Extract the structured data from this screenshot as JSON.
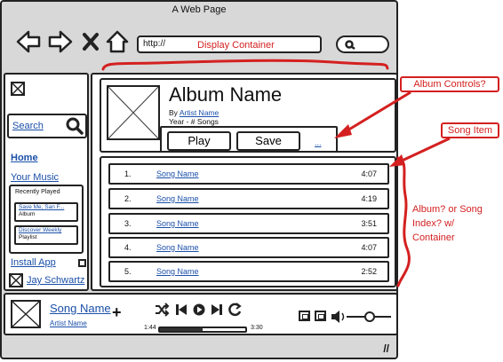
{
  "window": {
    "title": "A Web Page"
  },
  "toolbar": {
    "url_value": "http://",
    "display_container_label": "Display Container"
  },
  "sidebar": {
    "search_label": "Search",
    "home_label": "Home",
    "your_music_label": "Your Music",
    "recently_played_title": "Recently Played",
    "recent_items": [
      {
        "name": "Save Me, San F...",
        "type": "Album"
      },
      {
        "name": "Discover Weekly",
        "type": "Playlist"
      }
    ],
    "install_app_label": "Install App",
    "user_name": "Jay Schwartz"
  },
  "album": {
    "name": "Album Name",
    "by_prefix": "By",
    "artist": "Artist Name",
    "meta": "Year - # Songs",
    "play_label": "Play",
    "save_label": "Save",
    "more_label": "..."
  },
  "songs": [
    {
      "num": "1.",
      "name": "Song Name",
      "duration": "4:07"
    },
    {
      "num": "2.",
      "name": "Song Name",
      "duration": "4:19"
    },
    {
      "num": "3.",
      "name": "Song Name",
      "duration": "3:51"
    },
    {
      "num": "4.",
      "name": "Song Name",
      "duration": "4:07"
    },
    {
      "num": "5.",
      "name": "Song Name",
      "duration": "2:52"
    }
  ],
  "player": {
    "song": "Song Name",
    "artist": "Artist Name",
    "add_label": "+",
    "time_elapsed": "1:44",
    "time_total": "3:30",
    "progress": 0.5
  },
  "annotations": {
    "album_controls": "Album Controls?",
    "song_item": "Song Item",
    "album_or_song_index": "Album? or Song Index? w/ Container"
  },
  "colors": {
    "link": "#1a4fa8",
    "annotation": "#d42020",
    "chrome": "#d8d8d8"
  }
}
